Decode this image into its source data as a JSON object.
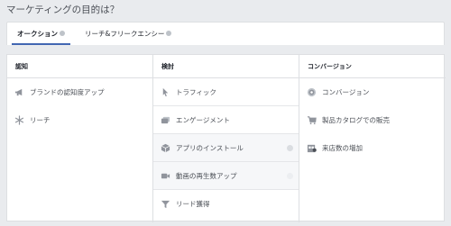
{
  "header": {
    "title": "マーケティングの目的は？"
  },
  "tabs": [
    {
      "label": "オークション",
      "active": true
    },
    {
      "label": "リーチ&フリークエンシー",
      "active": false
    }
  ],
  "columns": {
    "awareness": {
      "heading": "認知",
      "items": [
        {
          "label": "ブランドの認知度アップ",
          "icon": "megaphone-icon"
        },
        {
          "label": "リーチ",
          "icon": "snowflake-icon"
        }
      ]
    },
    "consideration": {
      "heading": "検討",
      "items": [
        {
          "label": "トラフィック",
          "icon": "cursor-icon"
        },
        {
          "label": "エンゲージメント",
          "icon": "chat-bubbles-icon"
        },
        {
          "label": "アプリのインストール",
          "icon": "cube-icon"
        },
        {
          "label": "動画の再生数アップ",
          "icon": "video-camera-icon"
        },
        {
          "label": "リード獲得",
          "icon": "funnel-icon"
        }
      ]
    },
    "conversion": {
      "heading": "コンバージョン",
      "items": [
        {
          "label": "コンバージョン",
          "icon": "globe-icon"
        },
        {
          "label": "製品カタログでの販売",
          "icon": "shopping-cart-icon"
        },
        {
          "label": "来店数の増加",
          "icon": "store-icon"
        }
      ]
    }
  },
  "colors": {
    "accent": "#4267b2",
    "icon": "#90949c",
    "border": "#dddfe2"
  }
}
